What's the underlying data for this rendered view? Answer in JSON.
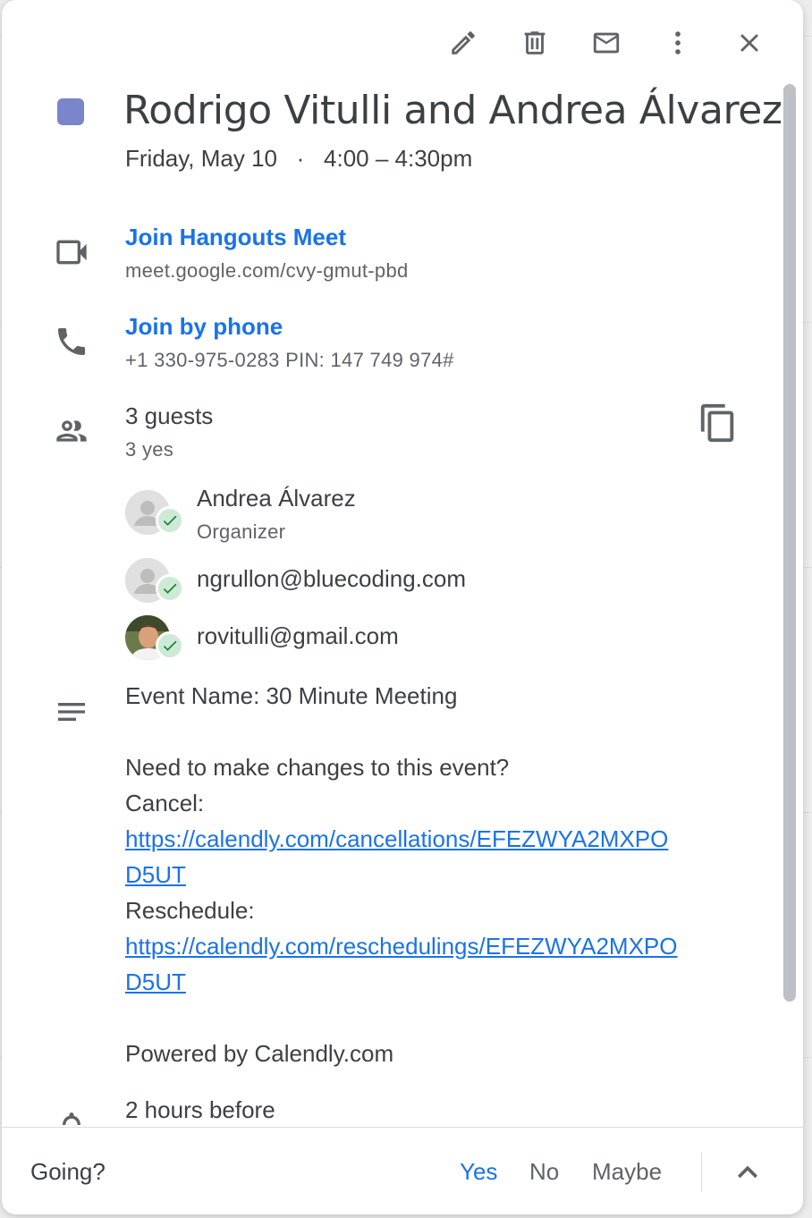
{
  "event": {
    "title": "Rodrigo Vitulli and Andrea Álvarez",
    "datetime": "Friday, May 10   ·   4:00 – 4:30pm",
    "color": "#7986cb"
  },
  "meet": {
    "label": "Join Hangouts Meet",
    "url": "meet.google.com/cvy-gmut-pbd"
  },
  "phone": {
    "label": "Join by phone",
    "details": "+1 330-975-0283 PIN: 147 749 974#"
  },
  "guests": {
    "count": "3 guests",
    "summary": "3 yes",
    "list": [
      {
        "name": "Andrea Álvarez",
        "role": "Organizer"
      },
      {
        "name": "ngrullon@bluecoding.com"
      },
      {
        "name": "rovitulli@gmail.com"
      }
    ]
  },
  "description": {
    "event_name": "Event Name: 30 Minute Meeting",
    "changes_question": "Need to make changes to this event?",
    "cancel_label": "Cancel:",
    "cancel_link_1": "https://calendly.com/cancellations/EFEZWYA2MXPO",
    "cancel_link_2": "D5UT",
    "reschedule_label": "Reschedule:",
    "reschedule_link_1": "https://calendly.com/reschedulings/EFEZWYA2MXPO",
    "reschedule_link_2": "D5UT",
    "powered_by": "Powered by Calendly.com"
  },
  "reminder": "2 hours before",
  "footer": {
    "going": "Going?",
    "yes": "Yes",
    "no": "No",
    "maybe": "Maybe"
  },
  "colors": {
    "accent": "#1a73e8",
    "accepted": "#188038"
  }
}
